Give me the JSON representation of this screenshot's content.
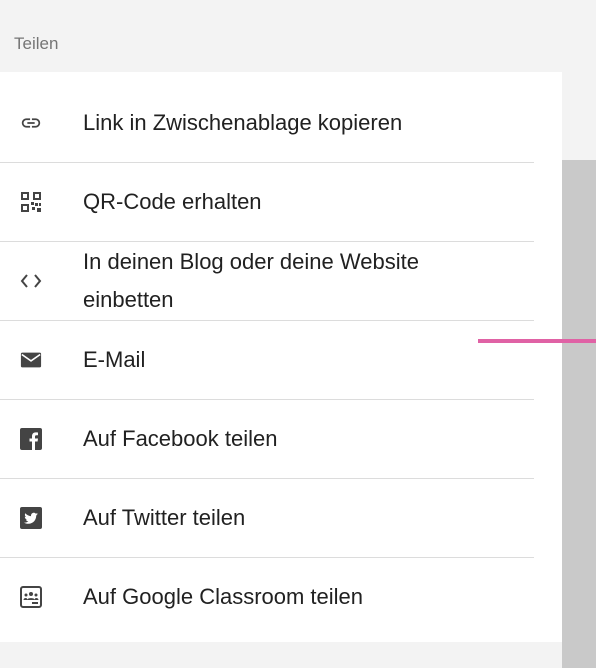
{
  "panel": {
    "title": "Teilen"
  },
  "share_items": [
    {
      "label": "Link in Zwischenablage kopieren",
      "icon": "link-icon"
    },
    {
      "label": "QR-Code erhalten",
      "icon": "qr-code-icon"
    },
    {
      "label": "In deinen Blog oder deine Website einbetten",
      "icon": "embed-code-icon"
    },
    {
      "label": "E-Mail",
      "icon": "email-icon"
    },
    {
      "label": "Auf Facebook teilen",
      "icon": "facebook-icon"
    },
    {
      "label": "Auf Twitter teilen",
      "icon": "twitter-icon"
    },
    {
      "label": "Auf Google Classroom teilen",
      "icon": "google-classroom-icon"
    }
  ],
  "colors": {
    "header_bg": "#f3f3f3",
    "icon": "#444444",
    "divider": "#dcdcdc",
    "scroll_thumb": "#c9c9c9",
    "accent_line": "#e062a5"
  }
}
